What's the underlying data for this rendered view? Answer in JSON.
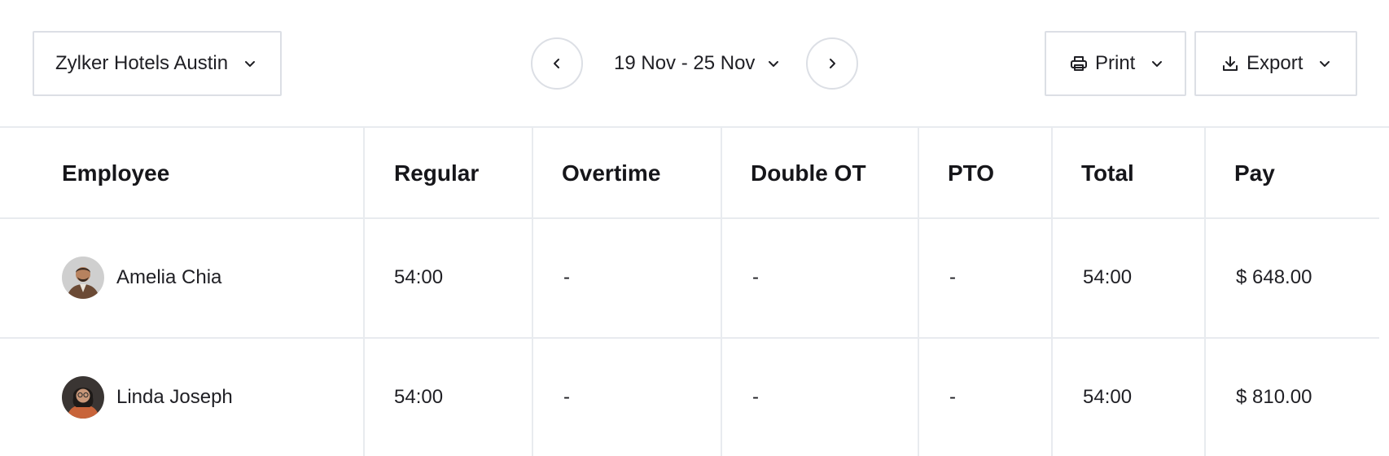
{
  "toolbar": {
    "location_label": "Zylker Hotels Austin",
    "date_range_label": "19 Nov - 25 Nov",
    "print_label": "Print",
    "export_label": "Export",
    "icons": {
      "location_dropdown": "chevron-down-icon",
      "prev": "chevron-left-icon",
      "next": "chevron-right-icon",
      "print": "printer-icon",
      "export": "download-icon"
    }
  },
  "table": {
    "columns": [
      "Employee",
      "Regular",
      "Overtime",
      "Double OT",
      "PTO",
      "Total",
      "Pay"
    ],
    "rows": [
      {
        "employee": "Amelia Chia",
        "regular": "54:00",
        "overtime": "-",
        "double_ot": "-",
        "pto": "-",
        "total": "54:00",
        "pay": "$ 648.00"
      },
      {
        "employee": "Linda Joseph",
        "regular": "54:00",
        "overtime": "-",
        "double_ot": "-",
        "pto": "-",
        "total": "54:00",
        "pay": "$ 810.00"
      }
    ]
  },
  "colors": {
    "border": "#dcdfe5",
    "grid": "#e8ebef",
    "text": "#1f1f24"
  }
}
